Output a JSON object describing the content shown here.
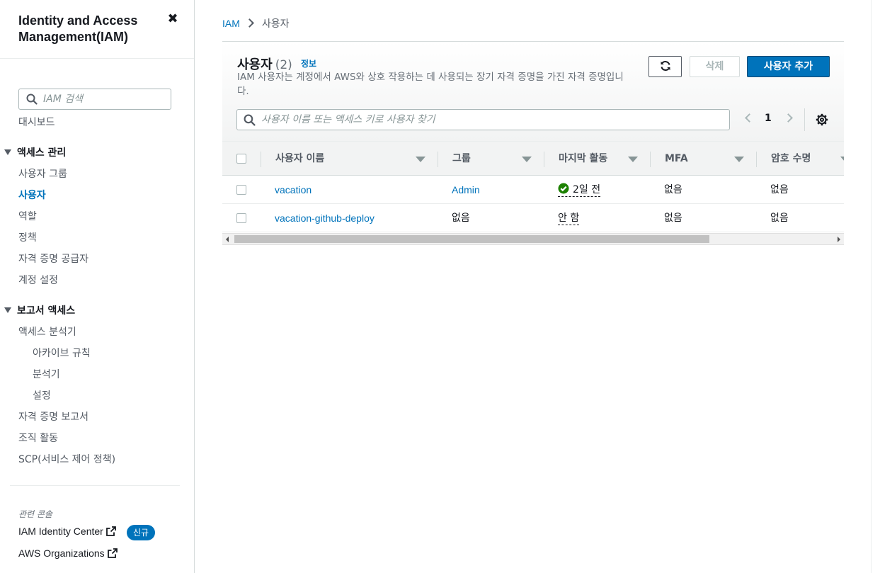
{
  "sidebar": {
    "title": "Identity and Access Management(IAM)",
    "close_symbol": "✖",
    "search_placeholder": "IAM 검색",
    "dashboard": "대시보드",
    "sections": [
      {
        "label": "액세스 관리",
        "items": [
          "사용자 그룹",
          "사용자",
          "역할",
          "정책",
          "자격 증명 공급자",
          "계정 설정"
        ],
        "active": "사용자"
      },
      {
        "label": "보고서 액세스",
        "items": [
          "액세스 분석기",
          "아카이브 규칙",
          "분석기",
          "설정",
          "자격 증명 보고서",
          "조직 활동",
          "SCP(서비스 제어 정책)"
        ]
      }
    ],
    "related_label": "관련 콘솔",
    "related_links": [
      {
        "label": "IAM Identity Center",
        "badge": "신규"
      },
      {
        "label": "AWS Organizations"
      }
    ]
  },
  "breadcrumb": {
    "root": "IAM",
    "current": "사용자"
  },
  "panel": {
    "title": "사용자",
    "count": "(2)",
    "info": "정보",
    "description": "IAM 사용자는 계정에서 AWS와 상호 작용하는 데 사용되는 장기 자격 증명을 가진 자격 증명입니다.",
    "buttons": {
      "refresh_icon": "refresh-icon",
      "delete": "삭제",
      "add_user": "사용자 추가"
    },
    "search_placeholder": "사용자 이름 또는 액세스 키로 사용자 찾기",
    "page": "1"
  },
  "table": {
    "columns": [
      "사용자 이름",
      "그룹",
      "마지막 활동",
      "MFA",
      "암호 수명"
    ],
    "rows": [
      {
        "user": "vacation",
        "group": "Admin",
        "last_activity": "2일 전",
        "last_activity_status": "success",
        "mfa": "없음",
        "password_age": "없음"
      },
      {
        "user": "vacation-github-deploy",
        "group": "없음",
        "last_activity": "안 함",
        "mfa": "없음",
        "password_age": "없음"
      }
    ]
  },
  "colors": {
    "link": "#0073bb",
    "primary_button": "#0073bb",
    "success": "#1d8102",
    "text": "#16191f",
    "muted": "#687078"
  }
}
